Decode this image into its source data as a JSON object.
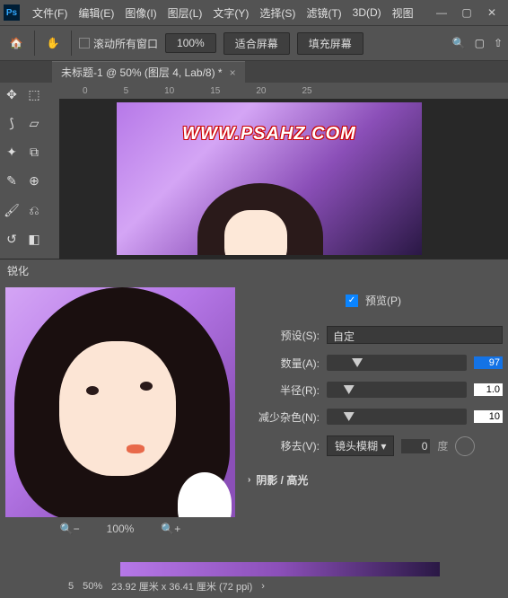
{
  "menu": {
    "items": [
      "文件(F)",
      "编辑(E)",
      "图像(I)",
      "图层(L)",
      "文字(Y)",
      "选择(S)",
      "滤镜(T)",
      "3D(D)",
      "视图"
    ]
  },
  "options": {
    "scroll_all": "滚动所有窗口",
    "zoom_pct": "100%",
    "fit_screen": "适合屏幕",
    "fill_screen": "填充屏幕"
  },
  "doc_tab": "未标题-1 @ 50% (图层 4, Lab/8) *",
  "ruler_marks": [
    "0",
    "5",
    "10",
    "15",
    "20",
    "25"
  ],
  "watermark": "WWW.PSAHZ.COM",
  "panel": {
    "title": "锐化",
    "preview_checkbox": "预览(P)",
    "preset_label": "预设(S):",
    "preset_value": "自定",
    "amount_label": "数量(A):",
    "amount_value": "97",
    "radius_label": "半径(R):",
    "radius_value": "1.0",
    "reduce_noise_label": "减少杂色(N):",
    "reduce_noise_value": "10",
    "remove_label": "移去(V):",
    "remove_value": "镜头模糊",
    "remove_deg": "0",
    "degree": "度",
    "shadow_highlight": "阴影 / 高光",
    "preview_zoom": "100%"
  },
  "status": {
    "zoom": "50%",
    "dimensions": "23.92 厘米 x 36.41 厘米 (72 ppi)",
    "ruler_v": "5"
  }
}
